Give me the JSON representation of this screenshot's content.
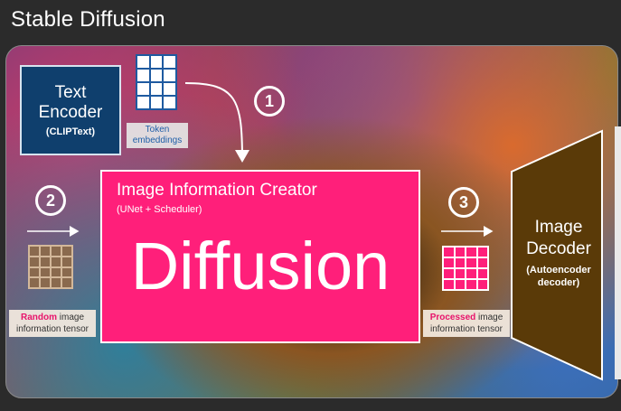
{
  "title": "Stable Diffusion",
  "text_encoder": {
    "title_line1": "Text",
    "title_line2": "Encoder",
    "subtitle": "(CLIPText)"
  },
  "token_embeddings": {
    "line1": "Token",
    "line2": "embeddings"
  },
  "steps": {
    "one": "1",
    "two": "2",
    "three": "3"
  },
  "creator": {
    "title": "Image Information Creator",
    "subtitle": "(UNet + Scheduler)",
    "big_label": "Diffusion"
  },
  "random_tensor": {
    "bold": "Random",
    "rest_line1": " image",
    "line2": "information tensor"
  },
  "processed_tensor": {
    "bold": "Processed",
    "rest_line1": " image",
    "line2": "information tensor"
  },
  "decoder": {
    "title_line1": "Image",
    "title_line2": "Decoder",
    "sub_line1": "(Autoencoder",
    "sub_line2": "decoder)"
  },
  "colors": {
    "encoder_blue": "#0f3f6d",
    "creator_pink": "#ff1f7a",
    "decoder_brown": "#5a3a08",
    "accent_pink_text": "#e8136b"
  }
}
